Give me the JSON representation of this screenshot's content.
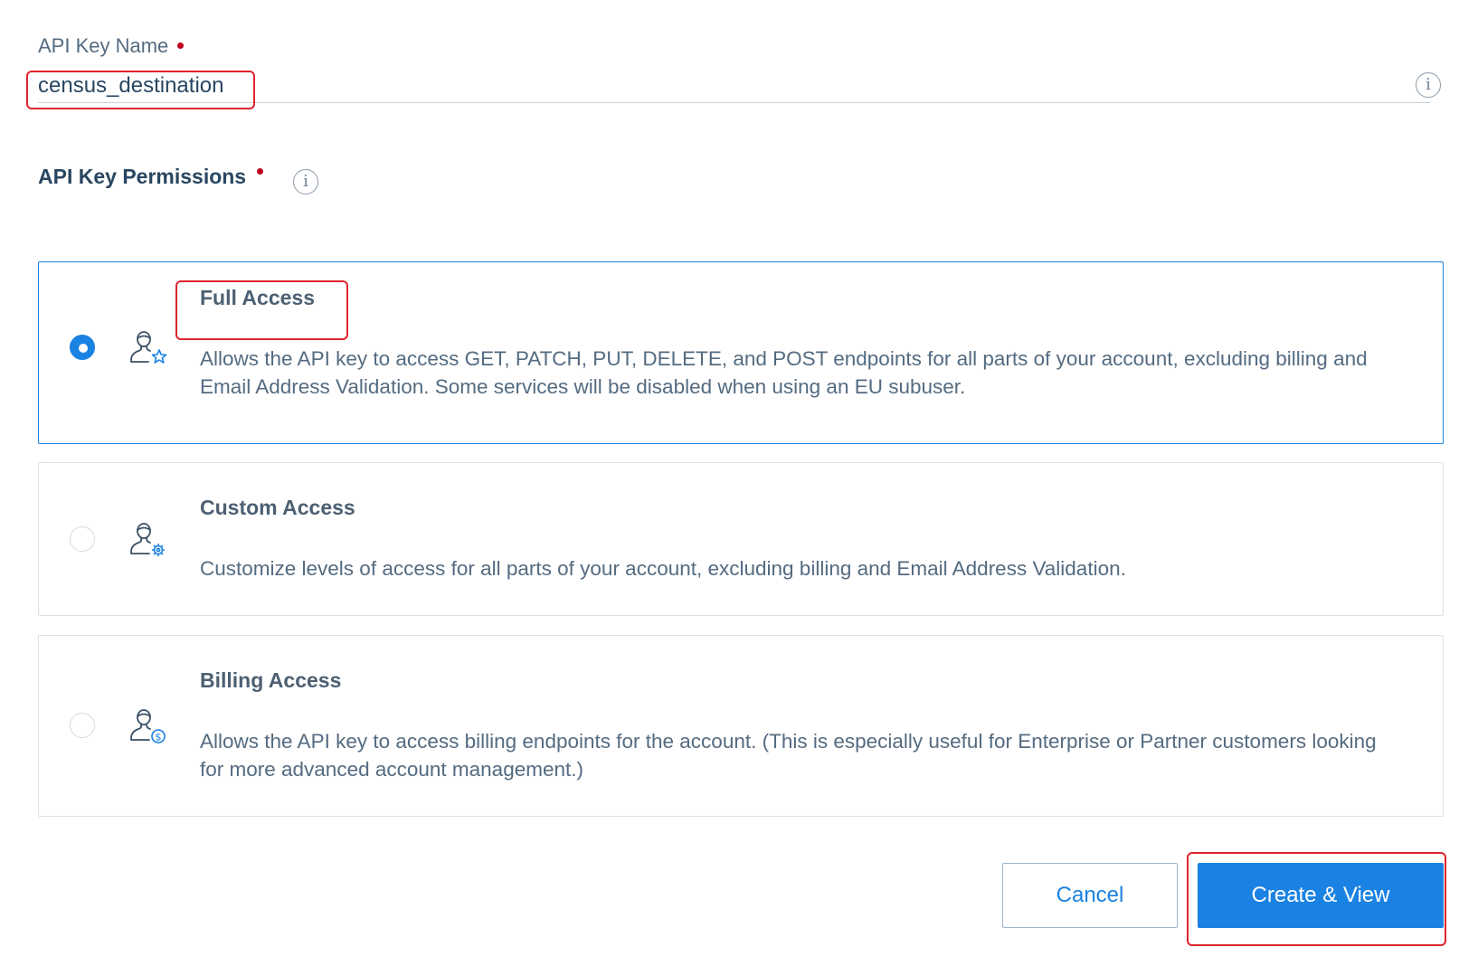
{
  "name_field": {
    "label": "API Key Name",
    "value": "census_destination"
  },
  "permissions": {
    "label": "API Key Permissions",
    "options": [
      {
        "title": "Full Access",
        "description": "Allows the API key to access GET, PATCH, PUT, DELETE, and POST endpoints for all parts of your account, excluding billing and Email Address Validation. Some services will be disabled when using an EU subuser.",
        "selected": true,
        "icon": "user-star-icon"
      },
      {
        "title": "Custom Access",
        "description": "Customize levels of access for all parts of your account, excluding billing and Email Address Validation.",
        "selected": false,
        "icon": "user-gear-icon"
      },
      {
        "title": "Billing Access",
        "description": "Allows the API key to access billing endpoints for the account. (This is especially useful for Enterprise or Partner customers looking for more advanced account management.)",
        "selected": false,
        "icon": "user-dollar-icon"
      }
    ]
  },
  "actions": {
    "cancel_label": "Cancel",
    "create_label": "Create & View"
  },
  "colors": {
    "accent": "#1a82e2",
    "required": "#c0001e",
    "highlight": "#e0242d"
  }
}
